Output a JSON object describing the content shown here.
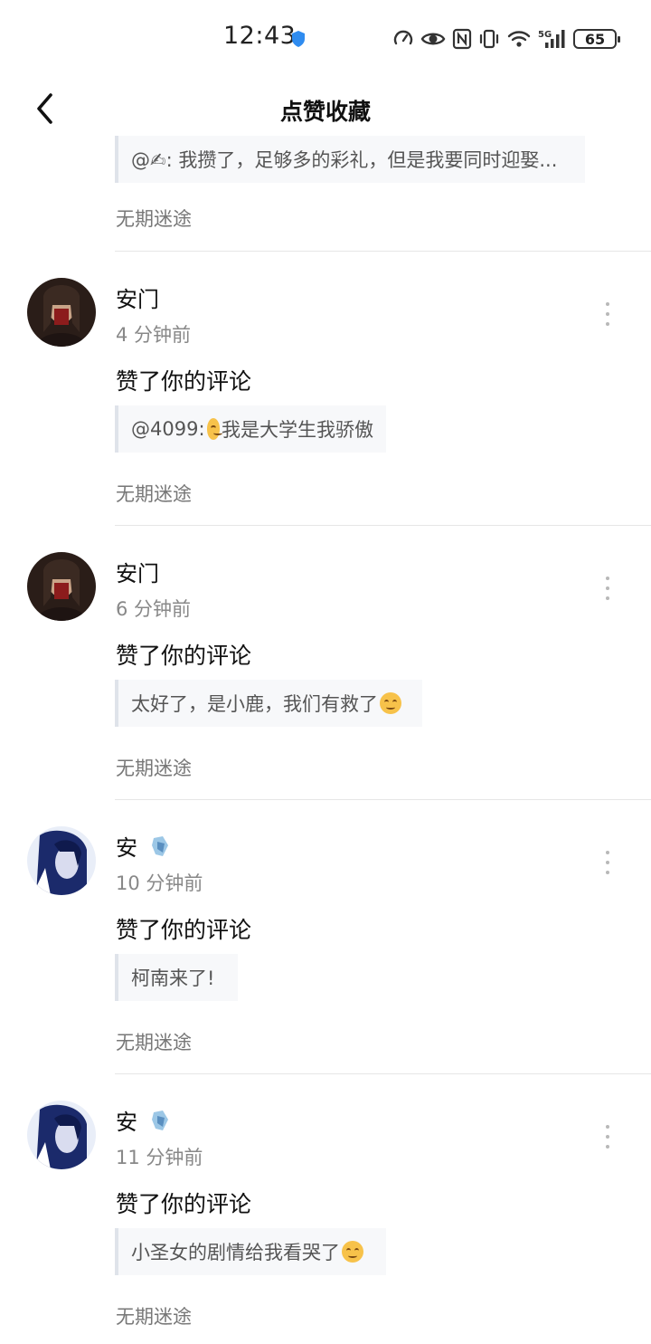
{
  "status_bar": {
    "time": "12:43",
    "battery": "65",
    "icons": [
      "speed-icon",
      "eye-icon",
      "nfc-icon",
      "vibrate-icon",
      "wifi-icon",
      "signal-5g-icon",
      "battery-icon"
    ]
  },
  "header": {
    "title": "点赞收藏"
  },
  "partial_item": {
    "quote": "@✍: 我攒了，足够多的彩礼，但是我要同时迎娶...",
    "source": "无期迷途"
  },
  "items": [
    {
      "user": "安门",
      "time": "4 分钟前",
      "action": "赞了你的评论",
      "quote_prefix": "@4099: ",
      "quote_text": "我是大学生我骄傲",
      "source": "无期迷途"
    },
    {
      "user": "安门",
      "time": "6 分钟前",
      "action": "赞了你的评论",
      "quote_text": "太好了，是小鹿，我们有救了",
      "source": "无期迷途"
    },
    {
      "user": "安",
      "time": "10 分钟前",
      "action": "赞了你的评论",
      "quote_text": "柯南来了!",
      "source": "无期迷途"
    },
    {
      "user": "安",
      "time": "11 分钟前",
      "action": "赞了你的评论",
      "quote_text": "小圣女的剧情给我看哭了",
      "source": "无期迷途"
    }
  ],
  "colors": {
    "accent_verified": "#2f8cf0",
    "quote_bg": "#f7f8fa",
    "quote_border": "#dfe3ea",
    "muted_text": "#888888"
  }
}
